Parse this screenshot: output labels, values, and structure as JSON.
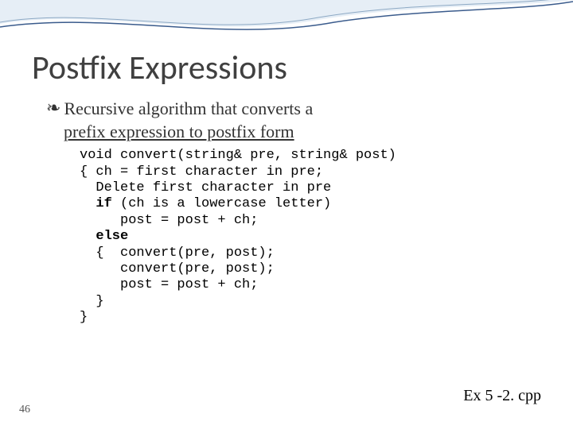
{
  "title": "Postfix Expressions",
  "bullet": {
    "line1": "Recursive algorithm that converts a",
    "line2": "prefix expression to postfix form"
  },
  "code": {
    "l1": "void convert(string& pre, string& post)",
    "l2": "{ ch = first character in pre;",
    "l3": "  Delete first character in pre",
    "l4a": "  ",
    "kw_if": "if",
    "l4b": " (ch is a lowercase letter)",
    "l5": "     post = post + ch;",
    "l6a": "  ",
    "kw_else": "else",
    "l7": "  {  convert(pre, post);",
    "l8": "     convert(pre, post);",
    "l9": "     post = post + ch;",
    "l10": "  }",
    "l11": "}"
  },
  "footer_ref": "Ex 5 -2. cpp",
  "page_num": "46"
}
